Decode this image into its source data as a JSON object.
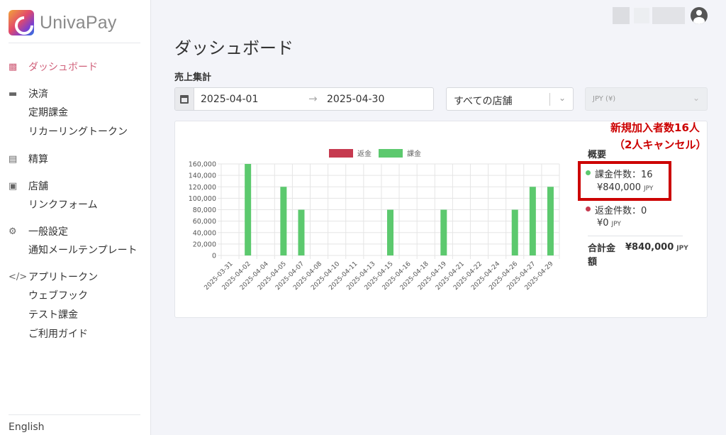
{
  "app": {
    "brand": "UnivaPay"
  },
  "sidebar": {
    "groups": [
      {
        "label": "ダッシュボード",
        "icon": "bar-chart-icon",
        "active": true,
        "items": []
      },
      {
        "label": "決済",
        "icon": "credit-card-icon",
        "items": [
          "定期課金",
          "リカーリングトークン"
        ]
      },
      {
        "label": "精算",
        "icon": "document-icon",
        "items": []
      },
      {
        "label": "店舗",
        "icon": "store-icon",
        "items": [
          "リンクフォーム"
        ]
      },
      {
        "label": "一般設定",
        "icon": "gear-icon",
        "items": [
          "通知メールテンプレート"
        ]
      },
      {
        "label": "アプリトークン",
        "icon": "code-icon",
        "items": [
          "ウェブフック",
          "テスト課金",
          "ご利用ガイド"
        ]
      }
    ],
    "language": "English"
  },
  "main": {
    "title": "ダッシュボード",
    "section": "売上集計",
    "filters": {
      "date_start": "2025-04-01",
      "date_end": "2025-04-30",
      "store": "すべての店舗",
      "currency": "JPY (¥)"
    }
  },
  "summary": {
    "label": "概要",
    "charge_count": "課金件数：16",
    "charge_amount": "¥840,000",
    "refund_count": "返金件数：0",
    "refund_amount": "¥0",
    "total_label": "合計金額",
    "total_amount": "¥840,000",
    "currency_unit": "JPY"
  },
  "annotation": {
    "line1": "新規加入者数16人",
    "line2": "（2人キャンセル）",
    "color": "#cc0000"
  },
  "colors": {
    "refund": "#c63a4f",
    "charge": "#5cc96e",
    "accent": "#d0607a"
  },
  "chart_data": {
    "type": "bar",
    "categories": [
      "2025-03-31",
      "2025-04-02",
      "2025-04-04",
      "2025-04-05",
      "2025-04-07",
      "2025-04-08",
      "2025-04-10",
      "2025-04-11",
      "2025-04-13",
      "2025-04-15",
      "2025-04-16",
      "2025-04-18",
      "2025-04-19",
      "2025-04-21",
      "2025-04-22",
      "2025-04-24",
      "2025-04-26",
      "2025-04-27",
      "2025-04-29"
    ],
    "series": [
      {
        "name": "返金",
        "values": [
          0,
          0,
          0,
          0,
          0,
          0,
          0,
          0,
          0,
          0,
          0,
          0,
          0,
          0,
          0,
          0,
          0,
          0,
          0
        ]
      },
      {
        "name": "課金",
        "values": [
          0,
          160000,
          0,
          120000,
          80000,
          0,
          0,
          0,
          0,
          80000,
          0,
          0,
          80000,
          0,
          0,
          0,
          80000,
          120000,
          120000
        ]
      }
    ],
    "y_ticks": [
      "0",
      "20,000",
      "40,000",
      "60,000",
      "80,000",
      "100,000",
      "120,000",
      "140,000",
      "160,000"
    ],
    "ylim": [
      0,
      160000
    ],
    "grid": true,
    "legend": "top"
  }
}
